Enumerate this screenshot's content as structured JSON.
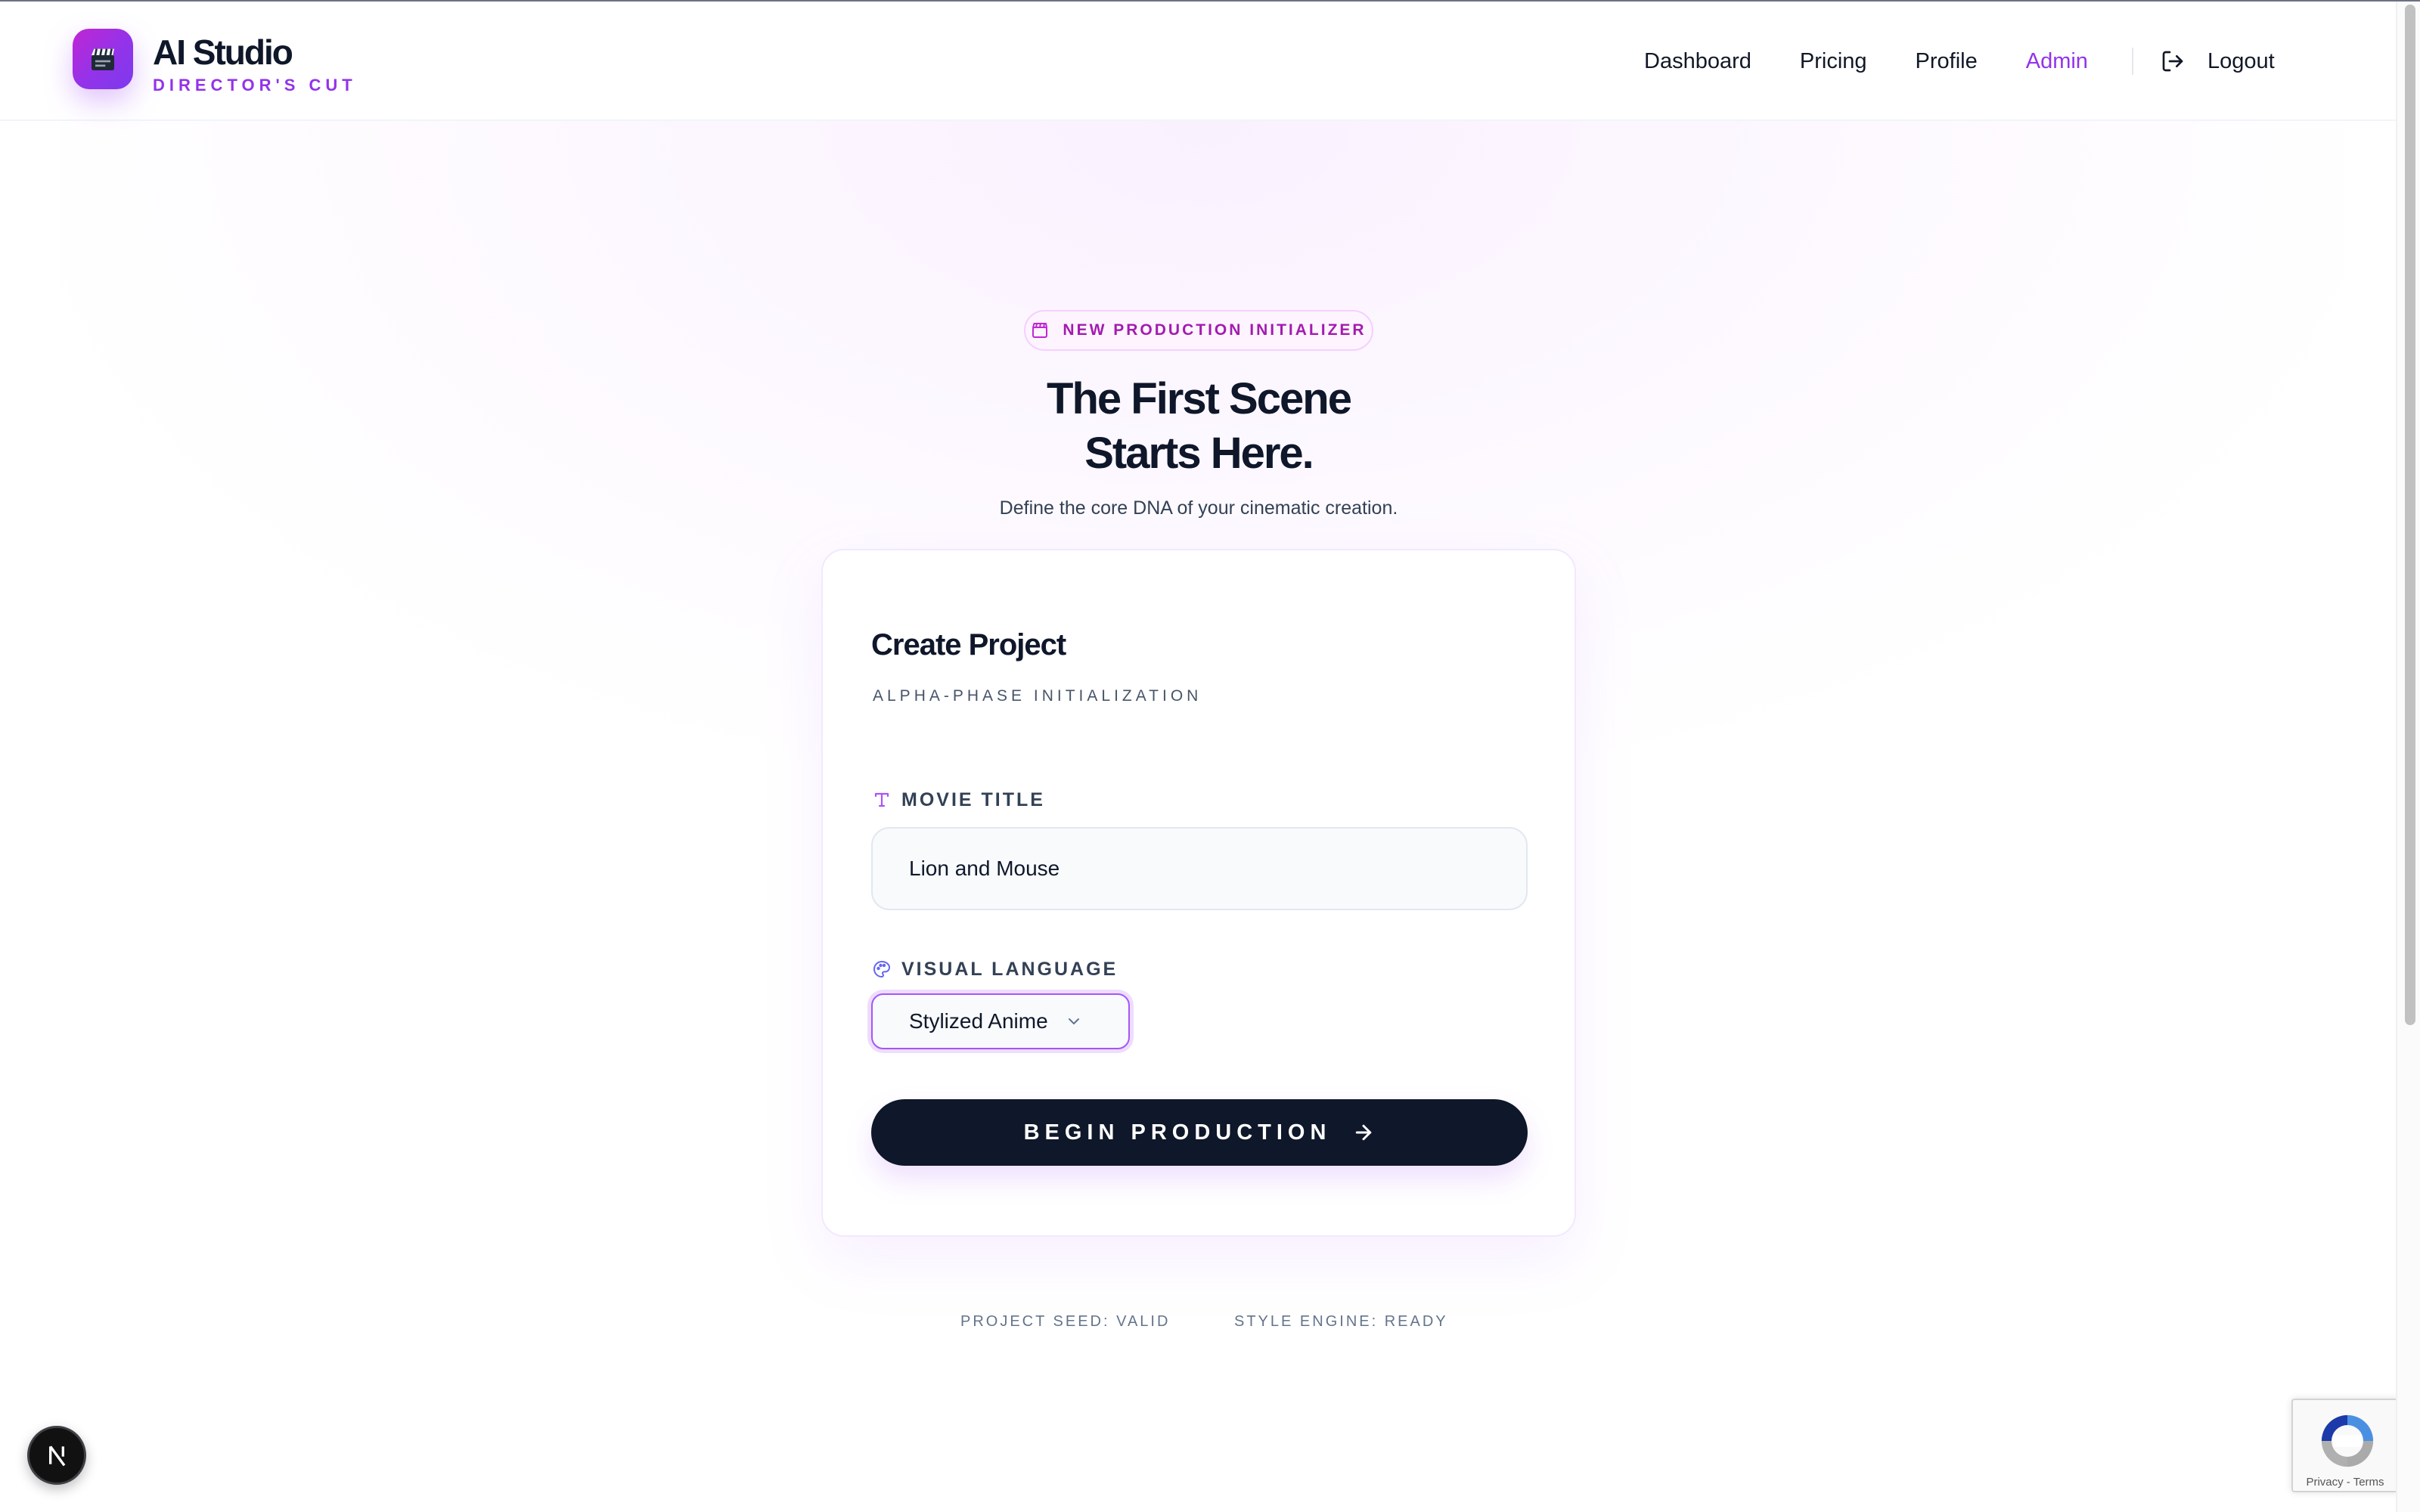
{
  "brand": {
    "title": "AI Studio",
    "subtitle": "DIRECTOR'S CUT",
    "logo_icon": "clapperboard-icon",
    "accent_color": "#9333ea"
  },
  "nav": {
    "items": [
      {
        "label": "Dashboard",
        "active": false
      },
      {
        "label": "Pricing",
        "active": false
      },
      {
        "label": "Profile",
        "active": false
      },
      {
        "label": "Admin",
        "active": true
      }
    ],
    "logout_label": "Logout",
    "logout_icon": "logout-icon"
  },
  "hero": {
    "badge_icon": "clapperboard-icon",
    "badge_label": "NEW PRODUCTION INITIALIZER",
    "title_line1": "The First Scene",
    "title_line2": "Starts Here.",
    "subtitle": "Define the core DNA of your cinematic creation."
  },
  "card": {
    "title": "Create Project",
    "subtitle": "ALPHA-PHASE INITIALIZATION",
    "movie_title": {
      "label": "MOVIE TITLE",
      "icon": "type-icon",
      "value": "Lion and Mouse"
    },
    "visual_language": {
      "label": "VISUAL LANGUAGE",
      "icon": "palette-icon",
      "selected": "Stylized Anime"
    },
    "submit_label": "BEGIN PRODUCTION",
    "submit_icon": "arrow-right-icon"
  },
  "status": {
    "project_seed": "PROJECT SEED: VALID",
    "style_engine": "STYLE ENGINE: READY"
  },
  "next_badge": "N",
  "recaptcha": {
    "privacy": "Privacy",
    "separator": " - ",
    "terms": "Terms"
  }
}
